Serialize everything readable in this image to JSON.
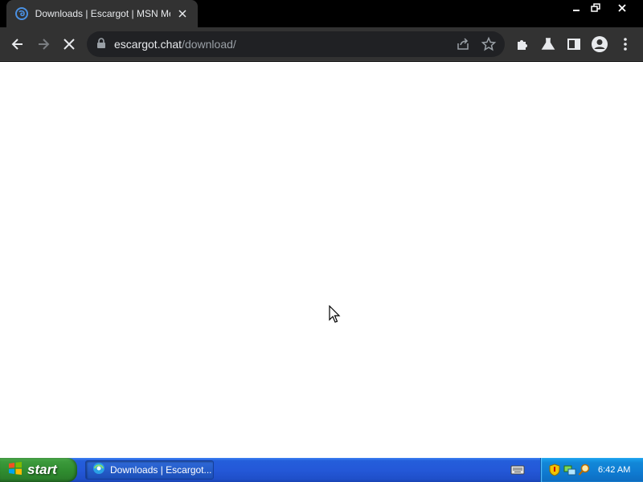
{
  "browser": {
    "tab": {
      "title": "Downloads | Escargot | MSN Messenger",
      "favicon": "escargot-logo-icon",
      "close": "close-tab-icon"
    },
    "window_controls": [
      "minimize-icon",
      "restore-icon",
      "close-icon"
    ],
    "toolbar": {
      "back": "arrow-left-icon",
      "forward": "arrow-right-icon",
      "stop": "stop-loading-icon",
      "extensions": "puzzle-icon",
      "labs": "flask-icon",
      "side_panel": "side-panel-icon",
      "profile": "profile-icon",
      "menu": "kebab-menu-icon"
    },
    "omnibox": {
      "host": "escargot.chat",
      "path": "/download/",
      "icons": [
        "lock-icon",
        "share-icon",
        "star-icon"
      ]
    }
  },
  "page": {
    "state": "loading",
    "background": "#ffffff"
  },
  "taskbar": {
    "start_label": "start",
    "task_label": "Downloads | Escargot...",
    "tray": {
      "icons": [
        "keyboard-icon",
        "security-shield-icon",
        "network-icon",
        "search-icon"
      ],
      "clock": "6:42 AM"
    }
  },
  "colors": {
    "chrome_dark": "#323232",
    "taskbar_blue": "#245edb",
    "start_green": "#3b9a3b",
    "tray_blue": "#0f7bd1"
  }
}
